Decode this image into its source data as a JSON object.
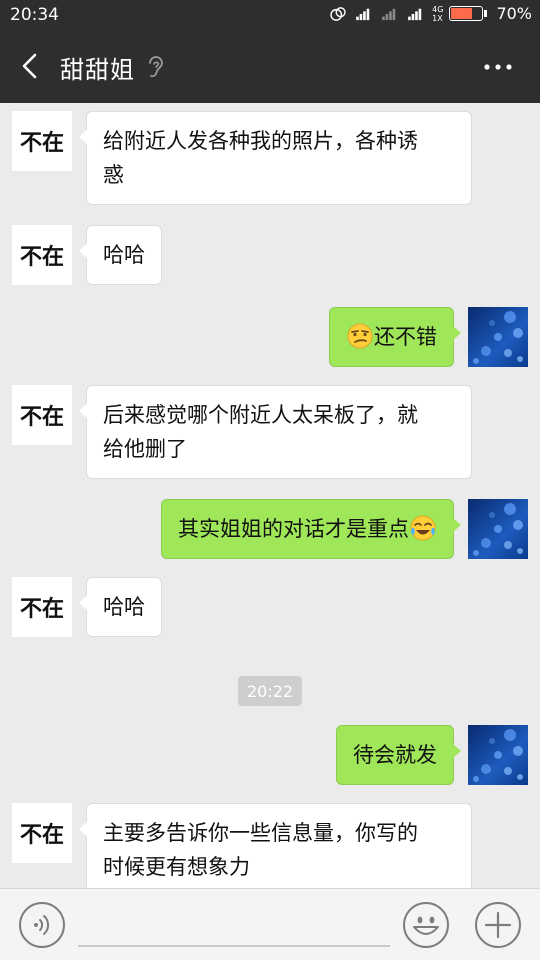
{
  "status_bar": {
    "time": "20:34",
    "network_top": "4G",
    "network_bottom": "1X",
    "battery_percent": "70%",
    "battery_level": 0.7,
    "icons": [
      "alarm-icon",
      "signal-icon",
      "signal-icon",
      "signal-icon",
      "battery-icon"
    ]
  },
  "header": {
    "title": "甜甜姐",
    "back_icon": "back-arrow-icon",
    "mode_icon": "earpiece-icon",
    "more_icon": "more-icon"
  },
  "messages": [
    {
      "side": "in",
      "avatar_text": "不在",
      "lines": [
        "给附近人发各种我的照片，各种诱",
        "惑"
      ]
    },
    {
      "side": "in",
      "avatar_text": "不在",
      "lines": [
        "哈哈"
      ]
    },
    {
      "side": "out",
      "emoji_before": "smirk-emoji",
      "text": "还不错"
    },
    {
      "side": "in",
      "avatar_text": "不在",
      "lines": [
        "后来感觉哪个附近人太呆板了，就",
        "给他删了"
      ]
    },
    {
      "side": "out",
      "text": "其实姐姐的对话才是重点",
      "emoji_after": "tears-of-joy-emoji"
    },
    {
      "side": "in",
      "avatar_text": "不在",
      "lines": [
        "哈哈"
      ]
    },
    {
      "side": "out",
      "text": "待会就发"
    },
    {
      "side": "in",
      "avatar_text": "不在",
      "lines": [
        "主要多告诉你一些信息量，你写的",
        "时候更有想象力"
      ]
    }
  ],
  "timestamp": "20:22",
  "input_bar": {
    "voice_icon": "voice-icon",
    "emoji_icon": "emoji-icon",
    "plus_icon": "plus-icon"
  },
  "colors": {
    "header_bg": "#2e2e2e",
    "chat_bg": "#ebebeb",
    "outgoing_bubble": "#9fe658",
    "incoming_bubble": "#ffffff",
    "battery_fill": "#ff6b4a"
  }
}
